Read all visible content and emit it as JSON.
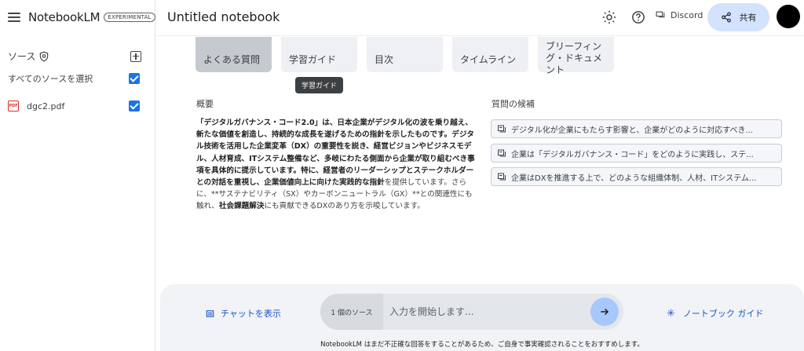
{
  "app": {
    "brand_name": "NotebookLM",
    "badge": "EXPERIMENTAL"
  },
  "sidebar": {
    "sources_title": "ソース",
    "select_all_label": "すべてのソースを選択",
    "files": [
      {
        "name": "dgc2.pdf",
        "icon": "pdf-icon",
        "checked": true
      }
    ]
  },
  "header": {
    "notebook_title": "Untitled notebook",
    "discord_label": "Discord",
    "share_label": "共有"
  },
  "guide_cards": [
    {
      "label": "よくある質問",
      "active": true
    },
    {
      "label": "学習ガイド",
      "active": false
    },
    {
      "label": "目次",
      "active": false
    },
    {
      "label": "タイムライン",
      "active": false
    },
    {
      "label": "ブリーフィング・ドキュメント",
      "active": false
    }
  ],
  "tooltip": "学習ガイド",
  "summary": {
    "label": "概要",
    "bold_part": "「デジタルガバナンス・コード2.0」は、日本企業がデジタル化の波を乗り越え、新たな価値を創造し、持続的な成長を遂げるための指針を示したものです。デジタル技術を活用した企業変革（DX）の重要性を説き、経営ビジョンやビジネスモデル、人材育成、ITシステム整備など、多岐にわたる側面から企業が取り組むべき事項を具体的に提示しています。特に、経営者のリーダーシップとステークホルダーとの対話を重視し、企業価値向上に向けた実践的な指針",
    "normal_part_1": "を提供しています。さらに、**サステナビリティ（SX）やカーボンニュートラル（GX）**との関連性にも触れ、",
    "bold_part_2": "社会課題解決",
    "normal_part_2": "にも貢献できるDXのあり方を示唆しています。"
  },
  "suggested": {
    "label": "質問の候補",
    "questions": [
      "デジタル化が企業にもたらす影響と、企業がどのように対応すべき...",
      "企業は「デジタルガバナンス・コード」をどのように実践し、ステ...",
      "企業はDXを推進する上で、どのような組織体制、人材、ITシステム..."
    ]
  },
  "chat": {
    "show_chat_label": "チャットを表示",
    "source_count": "1 個のソース",
    "input_placeholder": "入力を開始します...",
    "notebook_guide_label": "ノートブック ガイド",
    "disclaimer": "NotebookLM はまだ不正確な回答をすることがあるため、ご自身で事実確認されることをおすすめします。"
  },
  "colors": {
    "accent": "#1a73e8",
    "share_bg": "#d3e3fd",
    "send_bg": "#a8c7fa"
  }
}
